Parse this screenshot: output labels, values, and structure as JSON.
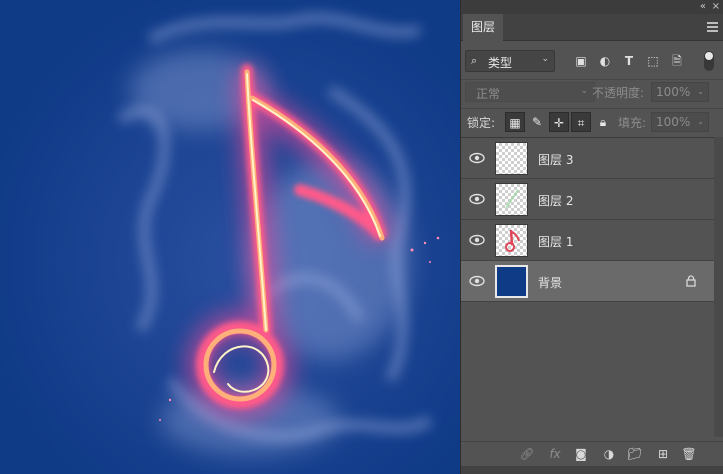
{
  "canvas": {
    "background_color": "#0f3a86",
    "artwork": "flaming music note"
  },
  "panel": {
    "collapse_icon": "«",
    "close_icon": "×",
    "tab_label": "图层",
    "menu_icon": "hamburger-menu-icon"
  },
  "filter": {
    "search_icon": "search-icon",
    "kind_label": "类型",
    "icons": [
      "image-filter-icon",
      "adjustment-filter-icon",
      "type-filter-icon",
      "shape-filter-icon",
      "smart-object-filter-icon"
    ]
  },
  "blend": {
    "mode": "正常",
    "opacity_label": "不透明度:",
    "opacity_value": "100%"
  },
  "lock": {
    "label": "锁定:",
    "fill_label": "填充:",
    "fill_value": "100%",
    "icons": [
      "lock-transparent-pixels-icon",
      "lock-image-pixels-icon",
      "lock-position-icon",
      "lock-artboard-icon",
      "lock-all-icon"
    ]
  },
  "layers": [
    {
      "name": "图层 3",
      "visible": true,
      "thumb": "transparent"
    },
    {
      "name": "图层 2",
      "visible": true,
      "thumb": "transparent-green"
    },
    {
      "name": "图层 1",
      "visible": true,
      "thumb": "transparent-red"
    },
    {
      "name": "背景",
      "visible": true,
      "thumb": "solid",
      "locked": true,
      "selected": true
    }
  ],
  "bottom_icons": [
    "link-layers-icon",
    "fx-icon",
    "add-mask-icon",
    "adjustment-layer-icon",
    "new-group-icon",
    "new-layer-icon",
    "delete-layer-icon"
  ],
  "colors": {
    "panel_bg": "#535353",
    "selected_row": "#6a6a6a",
    "canvas_blue": "#0f3a86"
  }
}
